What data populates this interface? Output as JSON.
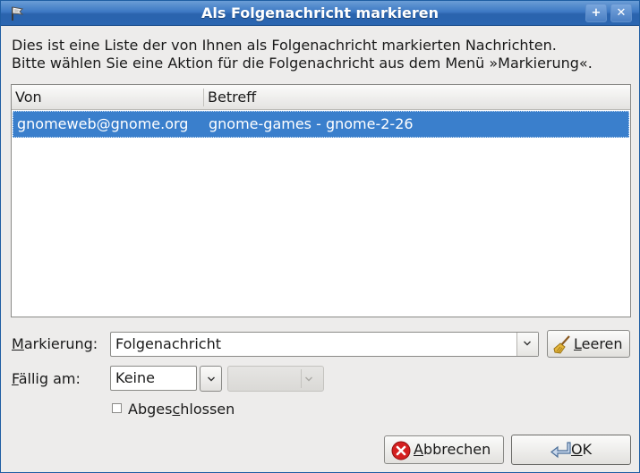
{
  "window": {
    "title": "Als Folgenachricht markieren",
    "icon": "flag-icon",
    "buttons": {
      "maximize": "+",
      "close": "✕"
    }
  },
  "description": {
    "line1": "Dies ist eine Liste der von Ihnen als Folgenachricht markierten Nachrichten.",
    "line2": "Bitte wählen Sie eine Aktion für die Folgenachricht aus dem Menü »Markierung«."
  },
  "message_list": {
    "columns": [
      "Von",
      "Betreff"
    ],
    "rows": [
      {
        "from": "gnomeweb@gnome.org",
        "subject": "gnome-games - gnome-2-26",
        "selected": true
      }
    ]
  },
  "flag": {
    "label_prefix": "",
    "label_mnemonic": "M",
    "label_rest": "arkierung:",
    "value": "Folgenachricht",
    "clear_button": {
      "mnemonic": "L",
      "rest": "eeren",
      "icon": "broom-icon"
    }
  },
  "due": {
    "label_mnemonic": "F",
    "label_rest": "ällig am:",
    "date_value": "Keine",
    "time_value": ""
  },
  "completed": {
    "label_pre": "Abges",
    "label_mnemonic": "c",
    "label_post": "hlossen",
    "checked": false
  },
  "actions": {
    "cancel": {
      "mnemonic": "A",
      "rest": "bbrechen",
      "icon": "cancel-icon"
    },
    "ok": {
      "mnemonic": "O",
      "rest": "K",
      "icon": "return-arrow-icon"
    }
  },
  "colors": {
    "titlebar": "#3d79c4",
    "selection": "#3a7fcc",
    "window_bg": "#edeceb",
    "cancel_red": "#d42020"
  }
}
